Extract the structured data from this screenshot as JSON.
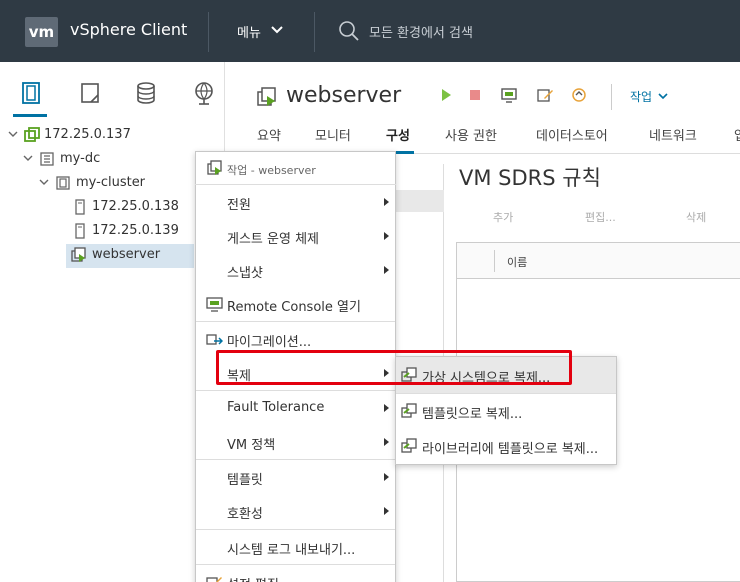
{
  "header": {
    "logo_text": "vm",
    "app_title": "vSphere Client",
    "menu_label": "메뉴",
    "search_placeholder": "모든 환경에서 검색"
  },
  "tree": {
    "items": [
      {
        "label": "172.25.0.137"
      },
      {
        "label": "my-dc"
      },
      {
        "label": "my-cluster"
      },
      {
        "label": "172.25.0.138"
      },
      {
        "label": "172.25.0.139"
      },
      {
        "label": "webserver"
      }
    ]
  },
  "vm": {
    "title": "webserver",
    "action_label": "작업"
  },
  "tabs": [
    {
      "label": "요약"
    },
    {
      "label": "모니터"
    },
    {
      "label": "구성"
    },
    {
      "label": "사용 권한"
    },
    {
      "label": "데이터스토어"
    },
    {
      "label": "네트워크"
    },
    {
      "label": "업"
    }
  ],
  "content": {
    "title": "VM SDRS 규칙",
    "buttons": {
      "add": "추가",
      "edit": "편집...",
      "delete": "삭제"
    },
    "column_name": "이름"
  },
  "context_menu": {
    "header": "작업 - webserver",
    "items": [
      {
        "label": "전원"
      },
      {
        "label": "게스트 운영 체제"
      },
      {
        "label": "스냅샷"
      },
      {
        "label": "Remote Console 열기"
      },
      {
        "label": "마이그레이션..."
      },
      {
        "label": "복제"
      },
      {
        "label": "Fault Tolerance"
      },
      {
        "label": "VM 정책"
      },
      {
        "label": "템플릿"
      },
      {
        "label": "호환성"
      },
      {
        "label": "시스템 로그 내보내기..."
      },
      {
        "label": "설정 편집..."
      }
    ]
  },
  "submenu": {
    "items": [
      {
        "label": "가상 시스템으로 복제..."
      },
      {
        "label": "템플릿으로 복제..."
      },
      {
        "label": "라이브러리에 템플릿으로 복제..."
      }
    ]
  },
  "colors": {
    "header_bg": "#2f3a44",
    "accent": "#0072a3",
    "highlight": "#e3000f",
    "vm_green": "#5aa220"
  }
}
